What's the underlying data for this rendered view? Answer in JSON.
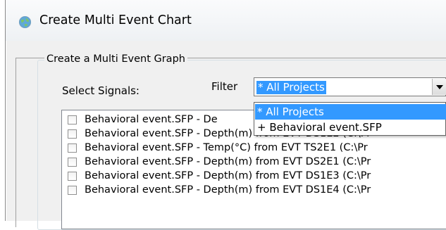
{
  "window": {
    "title": "Create Multi Event Chart",
    "icon": "globe-icon"
  },
  "group": {
    "legend": "Create a Multi Event Graph"
  },
  "signals": {
    "label": "Select Signals:"
  },
  "filter": {
    "label": "Filter",
    "selected": "* All Projects",
    "options": [
      "* All Projects",
      "+ Behavioral event.SFP"
    ]
  },
  "signal_list": [
    {
      "text": "Behavioral event.SFP - De",
      "checked": false
    },
    {
      "text": "Behavioral event.SFP - Depth(m) from EVT DS1E2 (C:\\Pr",
      "checked": false
    },
    {
      "text": "Behavioral event.SFP - Temp(°C) from EVT TS2E1 (C:\\Pr",
      "checked": false
    },
    {
      "text": "Behavioral event.SFP - Depth(m) from EVT DS2E1 (C:\\Pr",
      "checked": false
    },
    {
      "text": "Behavioral event.SFP - Depth(m) from EVT DS1E3 (C:\\Pr",
      "checked": false
    },
    {
      "text": "Behavioral event.SFP - Depth(m) from EVT DS1E4 (C:\\Pr",
      "checked": false
    }
  ],
  "colors": {
    "selection": "#3399ff",
    "window_bg": "#f0f0f0"
  }
}
